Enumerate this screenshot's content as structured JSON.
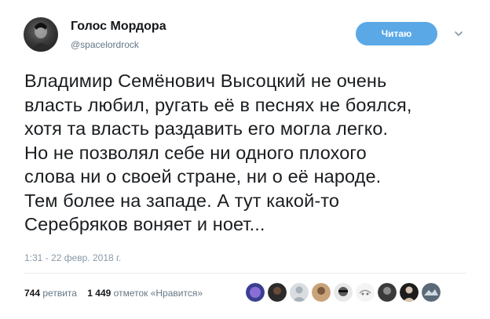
{
  "user": {
    "name": "Голос Мордора",
    "handle": "@spacelordrock"
  },
  "follow_button": {
    "label": "Читаю"
  },
  "tweet": {
    "lines": [
      "Владимир Семёнович Высоцкий не очень",
      "власть любил, ругать её в песнях не боялся,",
      "хотя та власть раздавить его могла легко.",
      "Но не позволял себе ни одного плохого",
      "слова ни о своей стране, ни о её народе.",
      "Тем более на западе. А тут какой-то",
      "Серебряков воняет и ноет..."
    ],
    "timestamp": "1:31 - 22 февр. 2018 г."
  },
  "stats": {
    "retweets_count": "744",
    "retweets_label": "ретвита",
    "likes_count": "1 449",
    "likes_label": "отметок «Нравится»"
  },
  "colors": {
    "follow_button_bg": "#5aa8e6",
    "secondary_text": "#657786"
  },
  "icons": {
    "more_menu": "chevron-down-icon"
  }
}
